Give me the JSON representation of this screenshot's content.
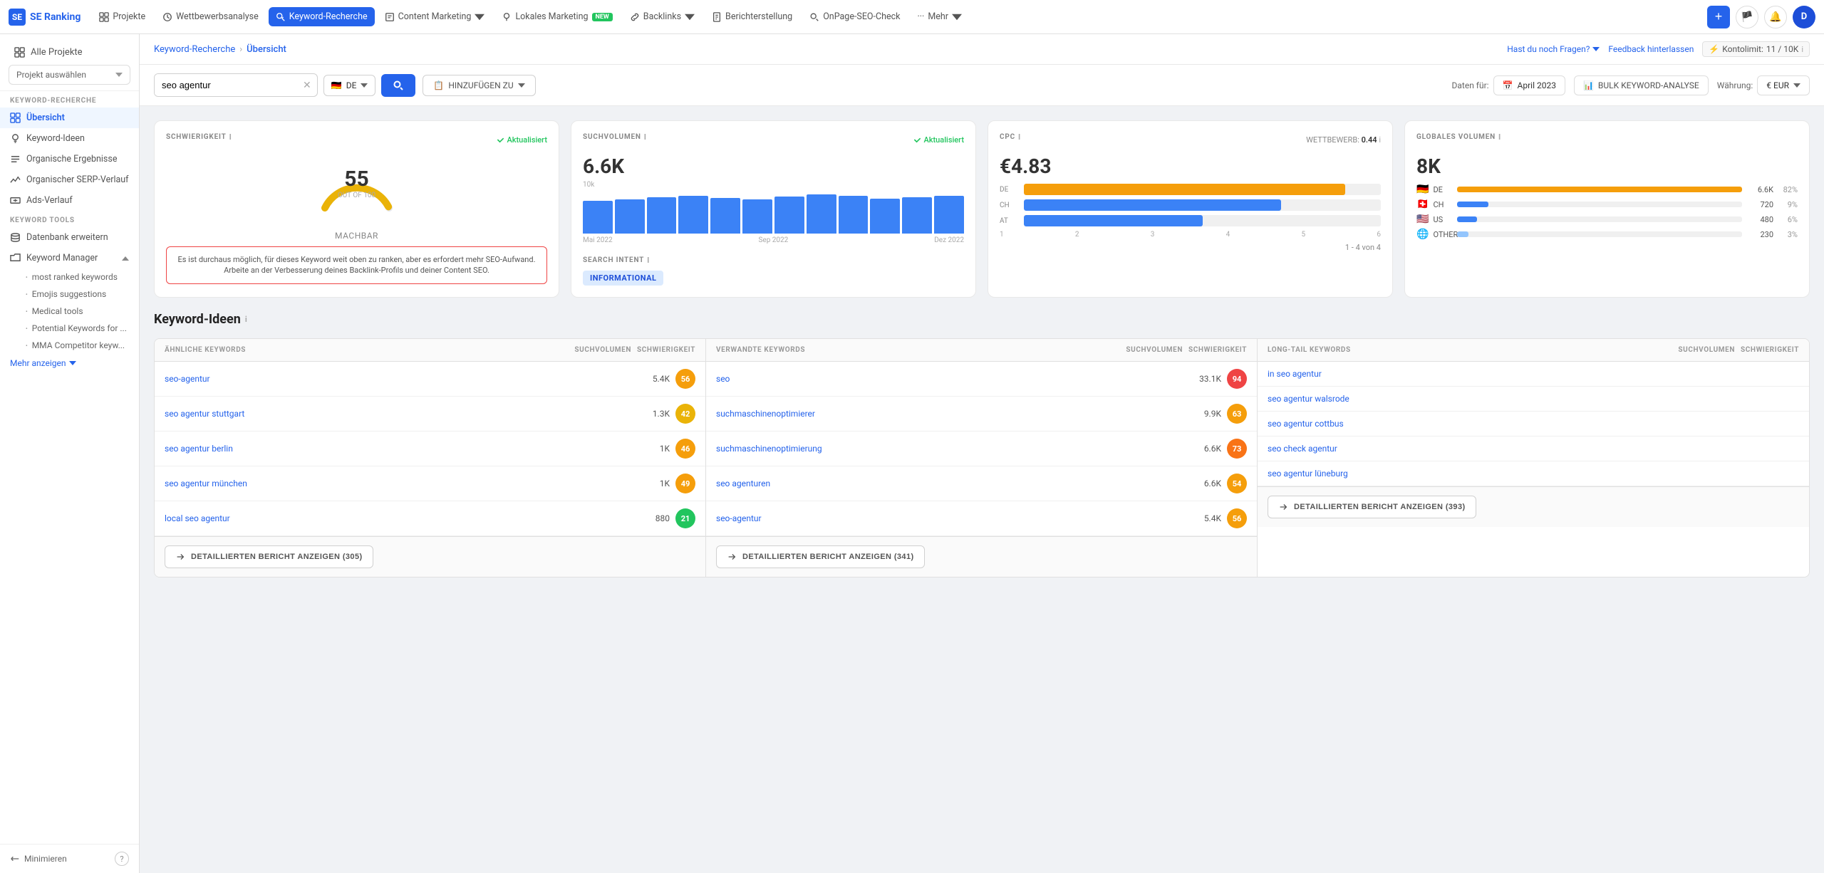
{
  "app": {
    "logo": "SE",
    "brand": "SE Ranking"
  },
  "nav": {
    "items": [
      {
        "id": "projekte",
        "label": "Projekte",
        "icon": "grid"
      },
      {
        "id": "wettbewerb",
        "label": "Wettbewerbsanalyse",
        "icon": "chart"
      },
      {
        "id": "keyword",
        "label": "Keyword-Recherche",
        "icon": "key",
        "active": true
      },
      {
        "id": "content",
        "label": "Content Marketing",
        "icon": "edit",
        "has_dropdown": true
      },
      {
        "id": "lokal",
        "label": "Lokales Marketing",
        "icon": "pin",
        "badge": "NEW",
        "has_dropdown": true
      },
      {
        "id": "backlinks",
        "label": "Backlinks",
        "icon": "link",
        "has_dropdown": true
      },
      {
        "id": "berichterstellung",
        "label": "Berichterstellung",
        "icon": "file"
      },
      {
        "id": "onpage",
        "label": "OnPage-SEO-Check",
        "icon": "search"
      },
      {
        "id": "mehr",
        "label": "Mehr",
        "icon": "dots",
        "has_dropdown": true
      }
    ],
    "plus_label": "+",
    "flag_icon": "🏴",
    "bell_icon": "🔔",
    "avatar_label": "D"
  },
  "sidebar": {
    "all_projects_label": "Alle Projekte",
    "project_placeholder": "Projekt auswählen",
    "section_keyword": "KEYWORD-RECHERCHE",
    "section_tools": "KEYWORD TOOLS",
    "keyword_items": [
      {
        "id": "ubersicht",
        "label": "Übersicht",
        "active": true
      },
      {
        "id": "keyword-ideen",
        "label": "Keyword-Ideen"
      },
      {
        "id": "organische",
        "label": "Organische Ergebnisse"
      },
      {
        "id": "organischer-serp",
        "label": "Organischer SERP-Verlauf"
      },
      {
        "id": "ads-verlauf",
        "label": "Ads-Verlauf"
      }
    ],
    "tool_items": [
      {
        "id": "datenbank",
        "label": "Datenbank erweitern"
      },
      {
        "id": "keyword-manager",
        "label": "Keyword Manager",
        "expandable": true
      }
    ],
    "manager_sub_items": [
      {
        "id": "most-ranked",
        "label": "most ranked keywords"
      },
      {
        "id": "emojis",
        "label": "Emojis suggestions"
      },
      {
        "id": "medical",
        "label": "Medical tools"
      },
      {
        "id": "potential",
        "label": "Potential Keywords for ..."
      },
      {
        "id": "mma",
        "label": "MMA Competitor keyw..."
      }
    ],
    "more_label": "Mehr anzeigen",
    "minimize_label": "Minimieren",
    "help_icon": "?"
  },
  "breadcrumb": {
    "root": "Keyword-Recherche",
    "current": "Übersicht"
  },
  "header_right": {
    "faq_label": "Hast du noch Fragen?",
    "feedback_label": "Feedback hinterlassen",
    "kontolimit_label": "Kontolimit:",
    "kontolimit_value": "11 / 10K",
    "kontolimit_icon": "⚡"
  },
  "search": {
    "query": "seo agentur",
    "flag": "🇩🇪",
    "flag_label": "DE",
    "search_btn_icon": "🔍",
    "add_label": "HINZUFÜGEN ZU",
    "add_icon": "📋"
  },
  "data_bar": {
    "daten_label": "Daten für:",
    "date_label": "April 2023",
    "date_icon": "📅",
    "bulk_label": "BULK KEYWORD-ANALYSE",
    "bulk_icon": "📊",
    "currency_label": "Währung:",
    "currency_value": "€ EUR"
  },
  "metrics": {
    "difficulty": {
      "label": "SCHWIERIGKEIT",
      "info": "i",
      "updated": "Aktualisiert",
      "value": 55,
      "max_label": "OUT OF 100",
      "feasibility": "MACHBAR",
      "alert_text": "Es ist durchaus möglich, für dieses Keyword weit oben zu ranken, aber es erfordert mehr SEO-Aufwand. Arbeite an der Verbesserung deines Backlink-Profils und deiner Content SEO.",
      "gauge_color": "#eab308",
      "gauge_bg": "#e5e7eb"
    },
    "search_volume": {
      "label": "SUCHVOLUMEN",
      "info": "i",
      "updated": "Aktualisiert",
      "value": "6.6K",
      "scale_max": "10k",
      "bars": [
        55,
        58,
        62,
        65,
        60,
        58,
        63,
        67,
        64,
        59,
        61,
        65
      ],
      "labels": [
        "Mai 2022",
        "Sep 2022",
        "Dez 2022"
      ]
    },
    "cpc": {
      "label": "CPC",
      "info": "i",
      "value": "€4.83",
      "wettbewerb_label": "WETTBEWERB:",
      "wettbewerb_value": "0.44",
      "wettbewerb_info": "i",
      "countries": [
        {
          "code": "DE",
          "fill_pct": 90,
          "type": "orange"
        },
        {
          "code": "CH",
          "fill_pct": 72,
          "type": "blue"
        },
        {
          "code": "AT",
          "fill_pct": 50,
          "type": "blue"
        }
      ],
      "axis_labels": [
        "1",
        "2",
        "3",
        "4",
        "5",
        "6"
      ],
      "pagination": "1 - 4 von 4"
    },
    "global_volume": {
      "label": "GLOBALES VOLUMEN",
      "info": "i",
      "value": "8K",
      "countries": [
        {
          "flag": "🇩🇪",
          "code": "DE",
          "count": "6.6K",
          "pct": "82%",
          "fill_pct": 100,
          "type": "orange"
        },
        {
          "flag": "🇨🇭",
          "code": "CH",
          "count": "720",
          "pct": "9%",
          "fill_pct": 11,
          "type": "blue"
        },
        {
          "flag": "🇺🇸",
          "code": "US",
          "count": "480",
          "pct": "6%",
          "fill_pct": 7,
          "type": "blue"
        },
        {
          "flag": "🌐",
          "code": "OTHER",
          "count": "230",
          "pct": "3%",
          "fill_pct": 4,
          "type": "light"
        }
      ]
    },
    "search_intent": {
      "label": "SEARCH INTENT",
      "info": "i",
      "badge": "INFORMATIONAL",
      "badge_type": "informational"
    }
  },
  "keyword_ideas": {
    "title": "Keyword-Ideen",
    "info": "i",
    "columns": [
      {
        "id": "aehnliche",
        "header": "ÄHNLICHE KEYWORDS",
        "col2": "SUCHVOLUMEN",
        "col3": "SCHWIERIGKEIT",
        "keywords": [
          {
            "text": "seo-agentur",
            "volume": "5.4K",
            "difficulty": 56,
            "diff_color": "orange"
          },
          {
            "text": "seo agentur stuttgart",
            "volume": "1.3K",
            "difficulty": 42,
            "diff_color": "yellow"
          },
          {
            "text": "seo agentur berlin",
            "volume": "1K",
            "difficulty": 46,
            "diff_color": "yellow"
          },
          {
            "text": "seo agentur münchen",
            "volume": "1K",
            "difficulty": 49,
            "diff_color": "yellow"
          },
          {
            "text": "local seo agentur",
            "volume": "880",
            "difficulty": 21,
            "diff_color": "green"
          }
        ],
        "report_label": "DETAILLIERTEN BERICHT ANZEIGEN (305)"
      },
      {
        "id": "verwandte",
        "header": "VERWANDTE KEYWORDS",
        "col2": "SUCHVOLUMEN",
        "col3": "SCHWIERIGKEIT",
        "keywords": [
          {
            "text": "seo",
            "volume": "33.1K",
            "difficulty": 94,
            "diff_color": "red"
          },
          {
            "text": "suchmaschinenoptimierer",
            "volume": "9.9K",
            "difficulty": 63,
            "diff_color": "orange"
          },
          {
            "text": "suchmaschinenoptimierung",
            "volume": "6.6K",
            "difficulty": 73,
            "diff_color": "orange2"
          },
          {
            "text": "seo agenturen",
            "volume": "6.6K",
            "difficulty": 54,
            "diff_color": "orange"
          },
          {
            "text": "seo-agentur",
            "volume": "5.4K",
            "difficulty": 56,
            "diff_color": "orange"
          }
        ],
        "report_label": "DETAILLIERTEN BERICHT ANZEIGEN (341)"
      },
      {
        "id": "longtail",
        "header": "LONG-TAIL KEYWORDS",
        "col2": "SUCHVOLUMEN",
        "col3": "SCHWIERIGKEIT",
        "keywords": [
          {
            "text": "in seo agentur",
            "volume": "",
            "difficulty": null
          },
          {
            "text": "seo agentur walsrode",
            "volume": "",
            "difficulty": null
          },
          {
            "text": "seo agentur cottbus",
            "volume": "",
            "difficulty": null
          },
          {
            "text": "seo check agentur",
            "volume": "",
            "difficulty": null
          },
          {
            "text": "seo agentur lüneburg",
            "volume": "",
            "difficulty": null
          }
        ],
        "report_label": "DETAILLIERTEN BERICHT ANZEIGEN (393)"
      }
    ]
  }
}
